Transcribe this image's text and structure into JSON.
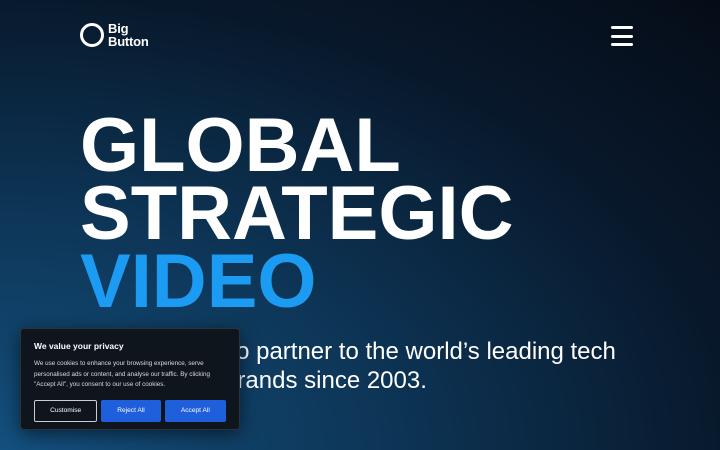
{
  "header": {
    "logo_line1": "Big",
    "logo_line2": "Button",
    "menu_icon": "hamburger-menu-icon"
  },
  "hero": {
    "title_line1": "GLOBAL",
    "title_line2": "STRATEGIC",
    "title_line3": "VIDEO",
    "subtitle": "A creative video partner to the world’s leading tech and software brands since 2003.",
    "accent_color": "#1c9bf2"
  },
  "cookie_banner": {
    "title": "We value your privacy",
    "body": "We use cookies to enhance your browsing experience, serve personalised ads or content, and analyse our traffic. By clicking \"Accept All\", you consent to our use of cookies.",
    "customise_label": "Customise",
    "reject_label": "Reject All",
    "accept_label": "Accept All",
    "button_color": "#1f5fdb"
  }
}
